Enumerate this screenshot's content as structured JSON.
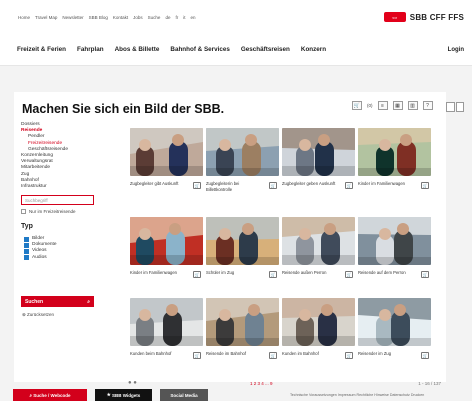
{
  "top_links": [
    "Home",
    "Travel Map",
    "Newsletter",
    "SBB Blog",
    "Kontakt",
    "Jobs",
    "Suche",
    "de",
    "fr",
    "it",
    "en"
  ],
  "brand": {
    "name": "SBB CFF FFS",
    "mark": "⇔",
    "accent": "#e2001a"
  },
  "main_nav": [
    "Freizeit & Ferien",
    "Fahrplan",
    "Abos & Billette",
    "Bahnhof & Services",
    "Geschäftsreisen",
    "Konzern"
  ],
  "login": "Login",
  "title": "Machen Sie sich ein Bild der SBB.",
  "tools": {
    "count": "(0)"
  },
  "sidebar": [
    {
      "label": "Dossiers",
      "style": ""
    },
    {
      "label": "Reisende",
      "style": "red bold"
    },
    {
      "label": "Pendler",
      "style": "indent"
    },
    {
      "label": "Freizeitreisende",
      "style": "red indent"
    },
    {
      "label": "Geschäftsreisende",
      "style": "indent"
    },
    {
      "label": "Konzernleitung",
      "style": ""
    },
    {
      "label": "Verwaltungsrat",
      "style": ""
    },
    {
      "label": "Mitarbeitende",
      "style": ""
    },
    {
      "label": "Zug",
      "style": ""
    },
    {
      "label": "Bahnhof",
      "style": ""
    },
    {
      "label": "Infrastruktur",
      "style": ""
    }
  ],
  "search": {
    "placeholder": "Suchbegriff",
    "only_freizeit": "Nur im Freizeitreisende"
  },
  "typ": {
    "title": "Typ",
    "items": [
      "Bilder",
      "Dokumente",
      "Videos",
      "Audios"
    ]
  },
  "search_button": "Suchen",
  "reset": "Zurücksetzen",
  "cards": [
    {
      "caption": "Zugbegleiter gibt Auskunft"
    },
    {
      "caption": "Zugbegleiterin bei Billettkontrolle"
    },
    {
      "caption": "Zugbegleiter geben Auskunft"
    },
    {
      "caption": "Kinder im Familienwagen"
    },
    {
      "caption": "Kinder im Familienwagen"
    },
    {
      "caption": "Schüler im Zug"
    },
    {
      "caption": "Reisende außen Perron"
    },
    {
      "caption": "Reisende auf dem Perron"
    },
    {
      "caption": "Kunden beim Bahnhof"
    },
    {
      "caption": "Reisende im Bahnhof"
    },
    {
      "caption": "Kunden im Bahnhof"
    },
    {
      "caption": "Reisender im Zug"
    }
  ],
  "pagination": "1 2 3 4 ... 9",
  "result_count": "1 - 16 / 137",
  "footer": {
    "search_label": "Suche / Webcode",
    "widgets_label": "SBB Widgets",
    "social_label": "Social Media",
    "links": "Technische Voraussetzungen  Impressum  Rechtliche Hinweise  Datenschutz  Drucken"
  }
}
